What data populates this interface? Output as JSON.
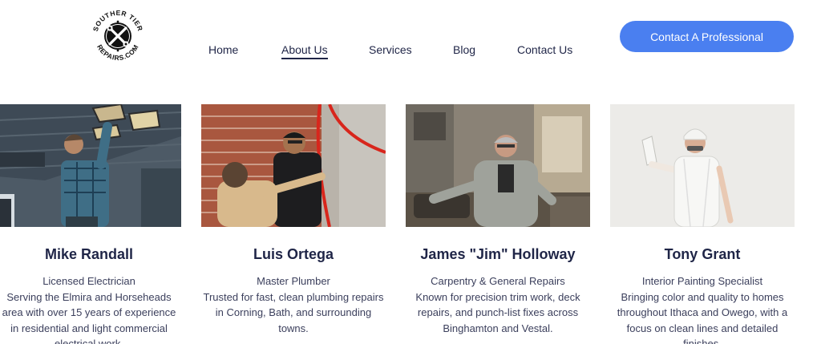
{
  "logo": {
    "top_text": "SOUTHER TIER",
    "bottom_text": "REPAIRS.COM",
    "icon": "crossed-wrench-screwdriver-icon"
  },
  "nav": {
    "items": [
      {
        "label": "Home"
      },
      {
        "label": "About Us"
      },
      {
        "label": "Services"
      },
      {
        "label": "Blog"
      },
      {
        "label": "Contact Us"
      }
    ],
    "active": "About Us"
  },
  "cta": {
    "label": "Contact A Professional"
  },
  "colors": {
    "accent": "#4a7ff0",
    "heading": "#1f2547",
    "body": "#3b3f5c"
  },
  "team": [
    {
      "name": "Mike Randall",
      "role": "Licensed Electrician",
      "description": "Serving the Elmira and Horseheads area with over 15 years of experience in residential and light commercial electrical work."
    },
    {
      "name": "Luis Ortega",
      "role": "Master Plumber",
      "description": "Trusted for fast, clean plumbing repairs in Corning, Bath, and surrounding towns."
    },
    {
      "name": "James \"Jim\" Holloway",
      "role": "Carpentry & General Repairs",
      "description": "Known for precision trim work, deck repairs, and punch-list fixes across Binghamton and Vestal."
    },
    {
      "name": "Tony Grant",
      "role": "Interior Painting Specialist",
      "description": "Bringing color and quality to homes throughout Ithaca and Owego, with a focus on clean lines and detailed finishes."
    }
  ]
}
